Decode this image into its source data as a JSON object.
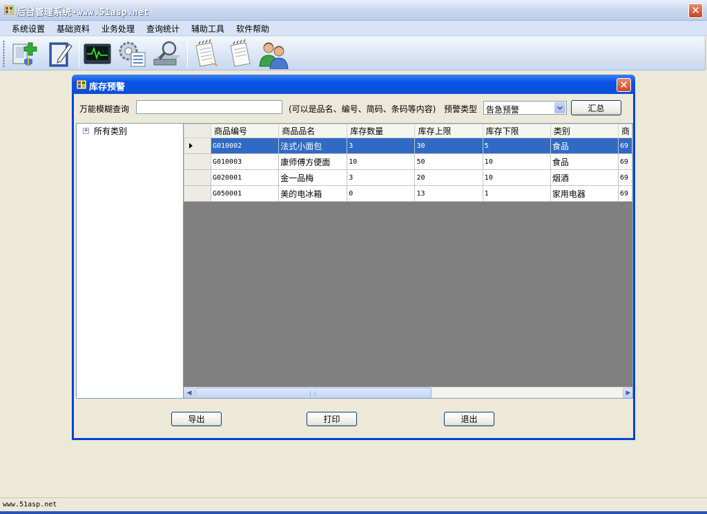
{
  "window": {
    "title": "后台管理系统-www.51asp.net",
    "close_glyph": "✕"
  },
  "menu": [
    "系统设置",
    "基础资料",
    "业务处理",
    "查询统计",
    "辅助工具",
    "软件帮助"
  ],
  "toolbar": {
    "buttons": [
      "add-item-icon",
      "edit-document-icon",
      "monitor-icon",
      "settings-checklist-icon",
      "search-drive-icon",
      "notepad-icon",
      "notepad-edit-icon",
      "users-icon"
    ]
  },
  "dialog": {
    "title": "库存预警",
    "close_glyph": "✕",
    "search_label": "万能模糊查询",
    "search_value": "",
    "hint": "(可以是品名、编号、简码、条码等内容)",
    "alert_type_label": "预警类型",
    "alert_type_value": "告急预警",
    "summary_button": "汇总",
    "tree": {
      "expander": "+",
      "root": "所有类别"
    },
    "grid": {
      "columns": [
        "商品编号",
        "商品品名",
        "库存数量",
        "库存上限",
        "库存下限",
        "类别",
        "商"
      ],
      "rows": [
        {
          "code": "G010002",
          "name": "法式小面包",
          "qty": "3",
          "upper": "30",
          "lower": "5",
          "category": "食品",
          "extra": "69",
          "selected": true
        },
        {
          "code": "G010003",
          "name": "康师傅方便面",
          "qty": "10",
          "upper": "50",
          "lower": "10",
          "category": "食品",
          "extra": "69",
          "selected": false
        },
        {
          "code": "G020001",
          "name": "金一品梅",
          "qty": "3",
          "upper": "20",
          "lower": "10",
          "category": "烟酒",
          "extra": "69",
          "selected": false
        },
        {
          "code": "G050001",
          "name": "美的电冰箱",
          "qty": "0",
          "upper": "13",
          "lower": "1",
          "category": "家用电器",
          "extra": "69",
          "selected": false
        }
      ]
    },
    "buttons": {
      "export": "导出",
      "print": "打印",
      "exit": "退出"
    }
  },
  "status": {
    "text": "www.51asp.net"
  },
  "colors": {
    "selection": "#316ac5",
    "dialog_title": "#0a52e4",
    "grid_empty": "#808080"
  }
}
